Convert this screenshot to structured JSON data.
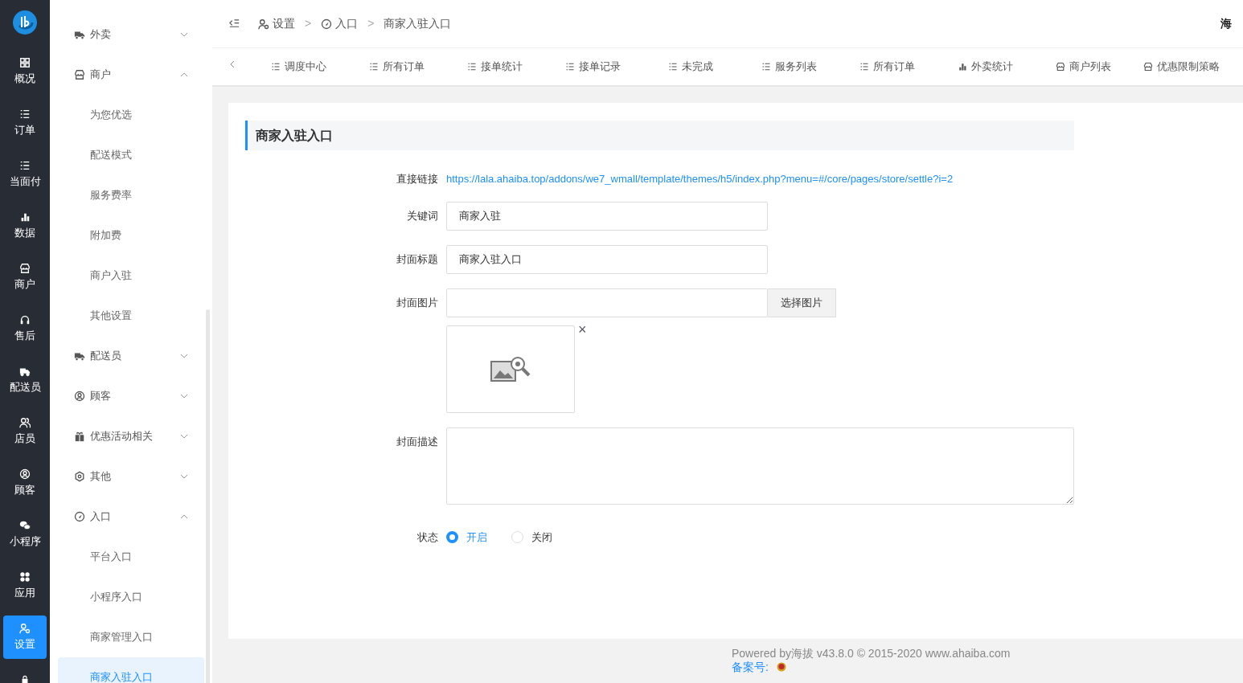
{
  "rail": {
    "items": [
      {
        "label": "概况",
        "selected": false
      },
      {
        "label": "订单",
        "selected": false
      },
      {
        "label": "当面付",
        "selected": false
      },
      {
        "label": "数据",
        "selected": false
      },
      {
        "label": "商户",
        "selected": false
      },
      {
        "label": "售后",
        "selected": false
      },
      {
        "label": "配送员",
        "selected": false
      },
      {
        "label": "店员",
        "selected": false
      },
      {
        "label": "顾客",
        "selected": false
      },
      {
        "label": "小程序",
        "selected": false
      },
      {
        "label": "应用",
        "selected": false
      },
      {
        "label": "设置",
        "selected": true
      },
      {
        "selected": false
      }
    ]
  },
  "menu": {
    "groups": [
      {
        "label": "外卖",
        "expanded": false
      },
      {
        "label": "商户",
        "expanded": true,
        "children": [
          {
            "label": "为您优选",
            "selected": false
          },
          {
            "label": "配送模式",
            "selected": false
          },
          {
            "label": "服务费率",
            "selected": false
          },
          {
            "label": "附加费",
            "selected": false
          },
          {
            "label": "商户入驻",
            "selected": false
          },
          {
            "label": "其他设置",
            "selected": false
          }
        ]
      },
      {
        "label": "配送员",
        "expanded": false
      },
      {
        "label": "顾客",
        "expanded": false
      },
      {
        "label": "优惠活动相关",
        "expanded": false
      },
      {
        "label": "其他",
        "expanded": false
      },
      {
        "label": "入口",
        "expanded": true,
        "children": [
          {
            "label": "平台入口",
            "selected": false
          },
          {
            "label": "小程序入口",
            "selected": false
          },
          {
            "label": "商家管理入口",
            "selected": false
          },
          {
            "label": "商家入驻入口",
            "selected": true
          }
        ]
      }
    ]
  },
  "breadcrumb": [
    {
      "label": "设置"
    },
    {
      "separator": ">",
      "label": "入口"
    },
    {
      "separator": ">",
      "label": "商家入驻入口"
    }
  ],
  "header_user": "海",
  "tabs": [
    {
      "label": "调度中心"
    },
    {
      "label": "所有订单"
    },
    {
      "label": "接单统计"
    },
    {
      "label": "接单记录"
    },
    {
      "label": "未完成"
    },
    {
      "label": "服务列表"
    },
    {
      "label": "所有订单"
    },
    {
      "label": "外卖统计"
    },
    {
      "label": "商户列表"
    },
    {
      "label": "优惠限制策略"
    }
  ],
  "panel": {
    "title": "商家入驻入口",
    "fields": [
      {
        "kind": "link",
        "label": "直接链接",
        "value": "https://lala.ahaiba.top/addons/we7_wmall/template/themes/h5/index.php?menu=#/core/pages/store/settle?i=2"
      },
      {
        "kind": "input",
        "label": "关键词",
        "value": "商家入驻"
      },
      {
        "kind": "input",
        "label": "封面标题",
        "value": "商家入驻入口"
      },
      {
        "kind": "image",
        "label": "封面图片",
        "button": "选择图片",
        "close": "×"
      },
      {
        "kind": "textarea",
        "label": "封面描述"
      },
      {
        "kind": "radio",
        "label": "状态",
        "options": [
          {
            "label": "开启",
            "selected": true
          },
          {
            "label": "关闭",
            "selected": false
          }
        ]
      }
    ]
  },
  "footer": {
    "text": "Powered by海拔 v43.8.0 © 2015-2020 www.ahaiba.com",
    "record": "备案号:"
  }
}
